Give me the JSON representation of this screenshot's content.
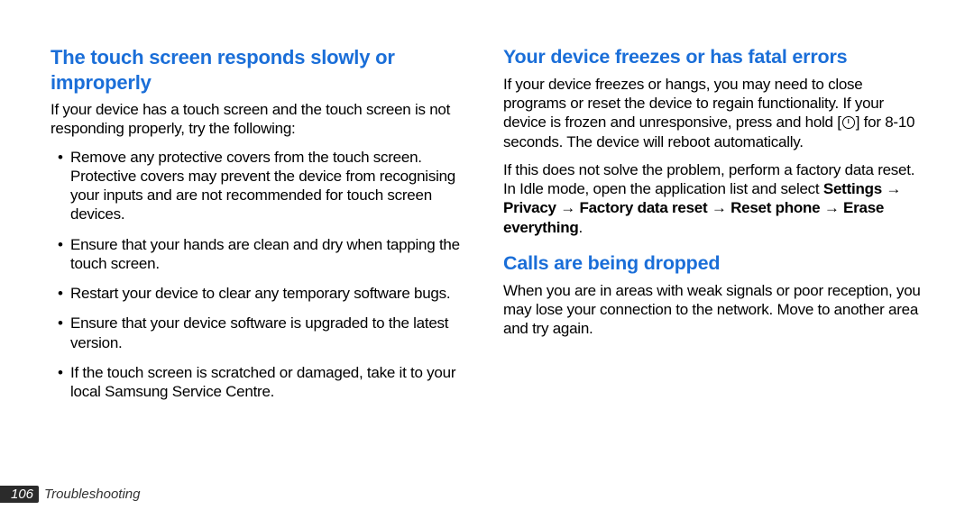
{
  "left": {
    "heading": "The touch screen responds slowly or improperly",
    "intro": "If your device has a touch screen and the touch screen is not responding properly, try the following:",
    "bullets": [
      "Remove any protective covers from the touch screen. Protective covers may prevent the device from recognising your inputs and are not recommended for touch screen devices.",
      "Ensure that your hands are clean and dry when tapping the touch screen.",
      "Restart your device to clear any temporary software bugs.",
      "Ensure that your device software is upgraded to the latest version.",
      "If the touch screen is scratched or damaged, take it to your local Samsung Service Centre."
    ]
  },
  "right": {
    "sections": [
      {
        "heading": "Your device freezes or has fatal errors",
        "para1_a": "If your device freezes or hangs, you may need to close programs or reset the device to regain functionality. If your device is frozen and unresponsive, press and hold [",
        "para1_b": "] for 8-10 seconds. The device will reboot automatically.",
        "para2_a": "If this does not solve the problem, perform a factory data reset. In Idle mode, open the application list and select ",
        "para2_bold": "Settings → Privacy → Factory data reset → Reset phone → Erase everything",
        "para2_b": "."
      },
      {
        "heading": "Calls are being dropped",
        "para": "When you are in areas with weak signals or poor reception, you may lose your connection to the network. Move to another area and try again."
      }
    ]
  },
  "footer": {
    "page": "106",
    "label": "Troubleshooting"
  }
}
